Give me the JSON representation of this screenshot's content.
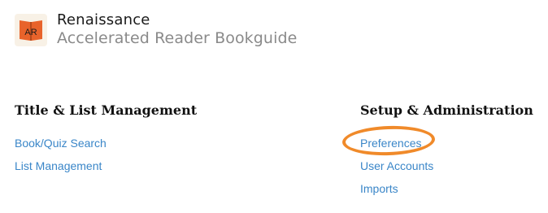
{
  "brand": {
    "name": "Renaissance",
    "product": "Accelerated Reader Bookguide",
    "logo_text": "AR",
    "logo_icon": "ar-book-logo",
    "accent_color": "#e8632b"
  },
  "sections": {
    "left": {
      "title": "Title & List Management",
      "links": [
        "Book/Quiz Search",
        "List Management"
      ]
    },
    "right": {
      "title": "Setup & Administration",
      "links": [
        "Preferences",
        "User Accounts",
        "Imports"
      ]
    }
  },
  "highlight": {
    "target": "Preferences",
    "color": "#f08a2a"
  },
  "link_color": "#3a86c8"
}
